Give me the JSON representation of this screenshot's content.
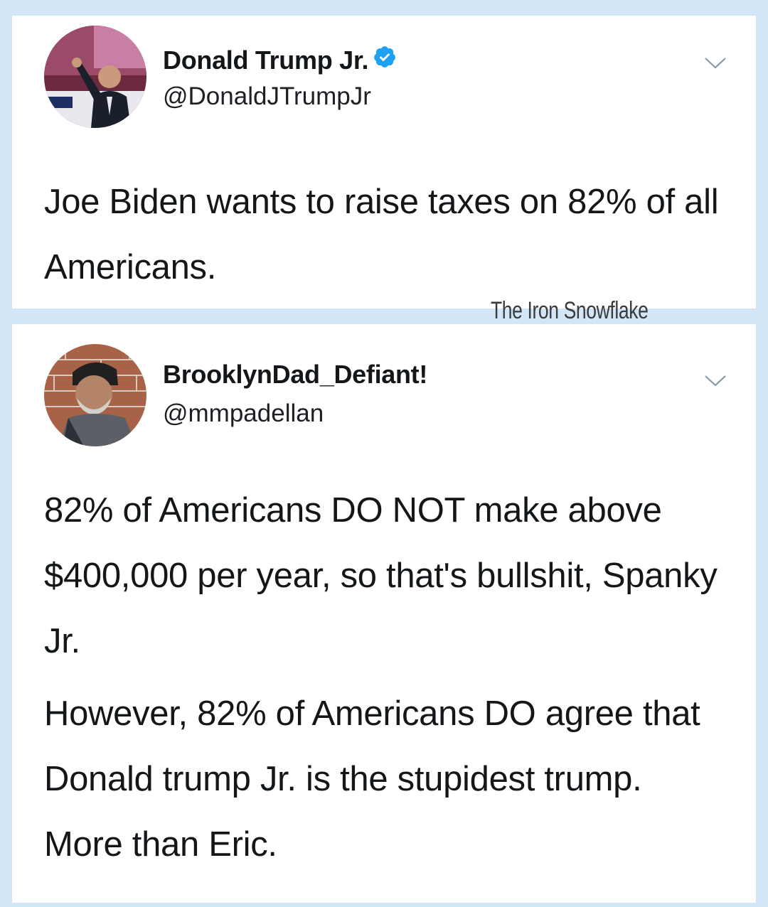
{
  "tweets": [
    {
      "name": "Donald Trump Jr.",
      "verified": true,
      "handle": "@DonaldJTrumpJr",
      "text": "Joe Biden wants to raise taxes on 82% of all Americans."
    },
    {
      "name": "BrooklynDad_Defiant!",
      "verified": false,
      "handle": "@mmpadellan",
      "paragraphs": [
        "82% of Americans DO NOT make above $400,000 per year, so that's bullshit, Spanky Jr.",
        "However, 82% of Americans DO agree that Donald trump Jr. is the stupidest trump. More than Eric."
      ]
    }
  ],
  "watermark": "The Iron Snowflake",
  "colors": {
    "background": "#d3e6f7",
    "card": "#ffffff",
    "text": "#14171a",
    "verified_badge": "#1da1f2",
    "chevron": "#8899a6"
  },
  "icons": {
    "verified": "verified-badge-icon",
    "chevron": "chevron-down-icon"
  }
}
